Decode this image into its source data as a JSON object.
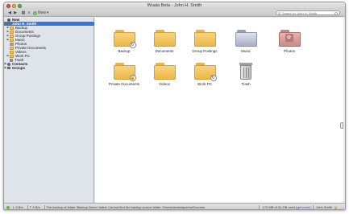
{
  "window": {
    "title": "Wuala Beta - John H. Smith"
  },
  "toolbar": {
    "back_icon": "back-arrow-icon",
    "forward_icon": "forward-arrow-icon",
    "new_label": "New",
    "new_arrow": "▾",
    "search": {
      "placeholder": "Search in John H. Smith"
    }
  },
  "sidebar": {
    "new_item": "New",
    "root": "John H. Smith",
    "items": [
      {
        "label": "Backup",
        "disclosure": "▶"
      },
      {
        "label": "Documents",
        "disclosure": "▶"
      },
      {
        "label": "Group Postings",
        "disclosure": "▶"
      },
      {
        "label": "Music",
        "disclosure": "▶"
      },
      {
        "label": "Photos",
        "disclosure": ""
      },
      {
        "label": "Private Documents",
        "disclosure": ""
      },
      {
        "label": "Videos",
        "disclosure": ""
      },
      {
        "label": "Work PC",
        "disclosure": "▶"
      },
      {
        "label": "Trash",
        "disclosure": ""
      }
    ],
    "contacts": "Contacts",
    "groups": "Groups"
  },
  "content": {
    "items": [
      {
        "label": "Backup",
        "type": "folder",
        "badge": "↻"
      },
      {
        "label": "Documents",
        "type": "folder",
        "badge": ""
      },
      {
        "label": "Group Postings",
        "type": "folder",
        "badge": ""
      },
      {
        "label": "Music",
        "type": "folder-music",
        "badge": ""
      },
      {
        "label": "Photos",
        "type": "folder-photos",
        "badge": ""
      },
      {
        "label": "Private Documents",
        "type": "folder",
        "badge": "🔒"
      },
      {
        "label": "Videos",
        "type": "folder",
        "badge": ""
      },
      {
        "label": "Work PC",
        "type": "folder",
        "badge": "↻"
      },
      {
        "label": "Trash",
        "type": "trash",
        "badge": ""
      }
    ]
  },
  "statusbar": {
    "download_rate": "⇣ 0 B/s",
    "upload_rate": "⇡ 0 B/s",
    "message": "The backup of folder 'Backup Demo' failed: Cannot find the backup source folder '/Users/dominiqueers/Docume",
    "usage": "170 MB of 51 GB used",
    "get_more": "(get more)",
    "user": "John Smith"
  },
  "colors": {
    "selection": "#3a76d6",
    "folder": "#f2c25b",
    "link": "#1a4fd6",
    "online": "#5fb548"
  }
}
